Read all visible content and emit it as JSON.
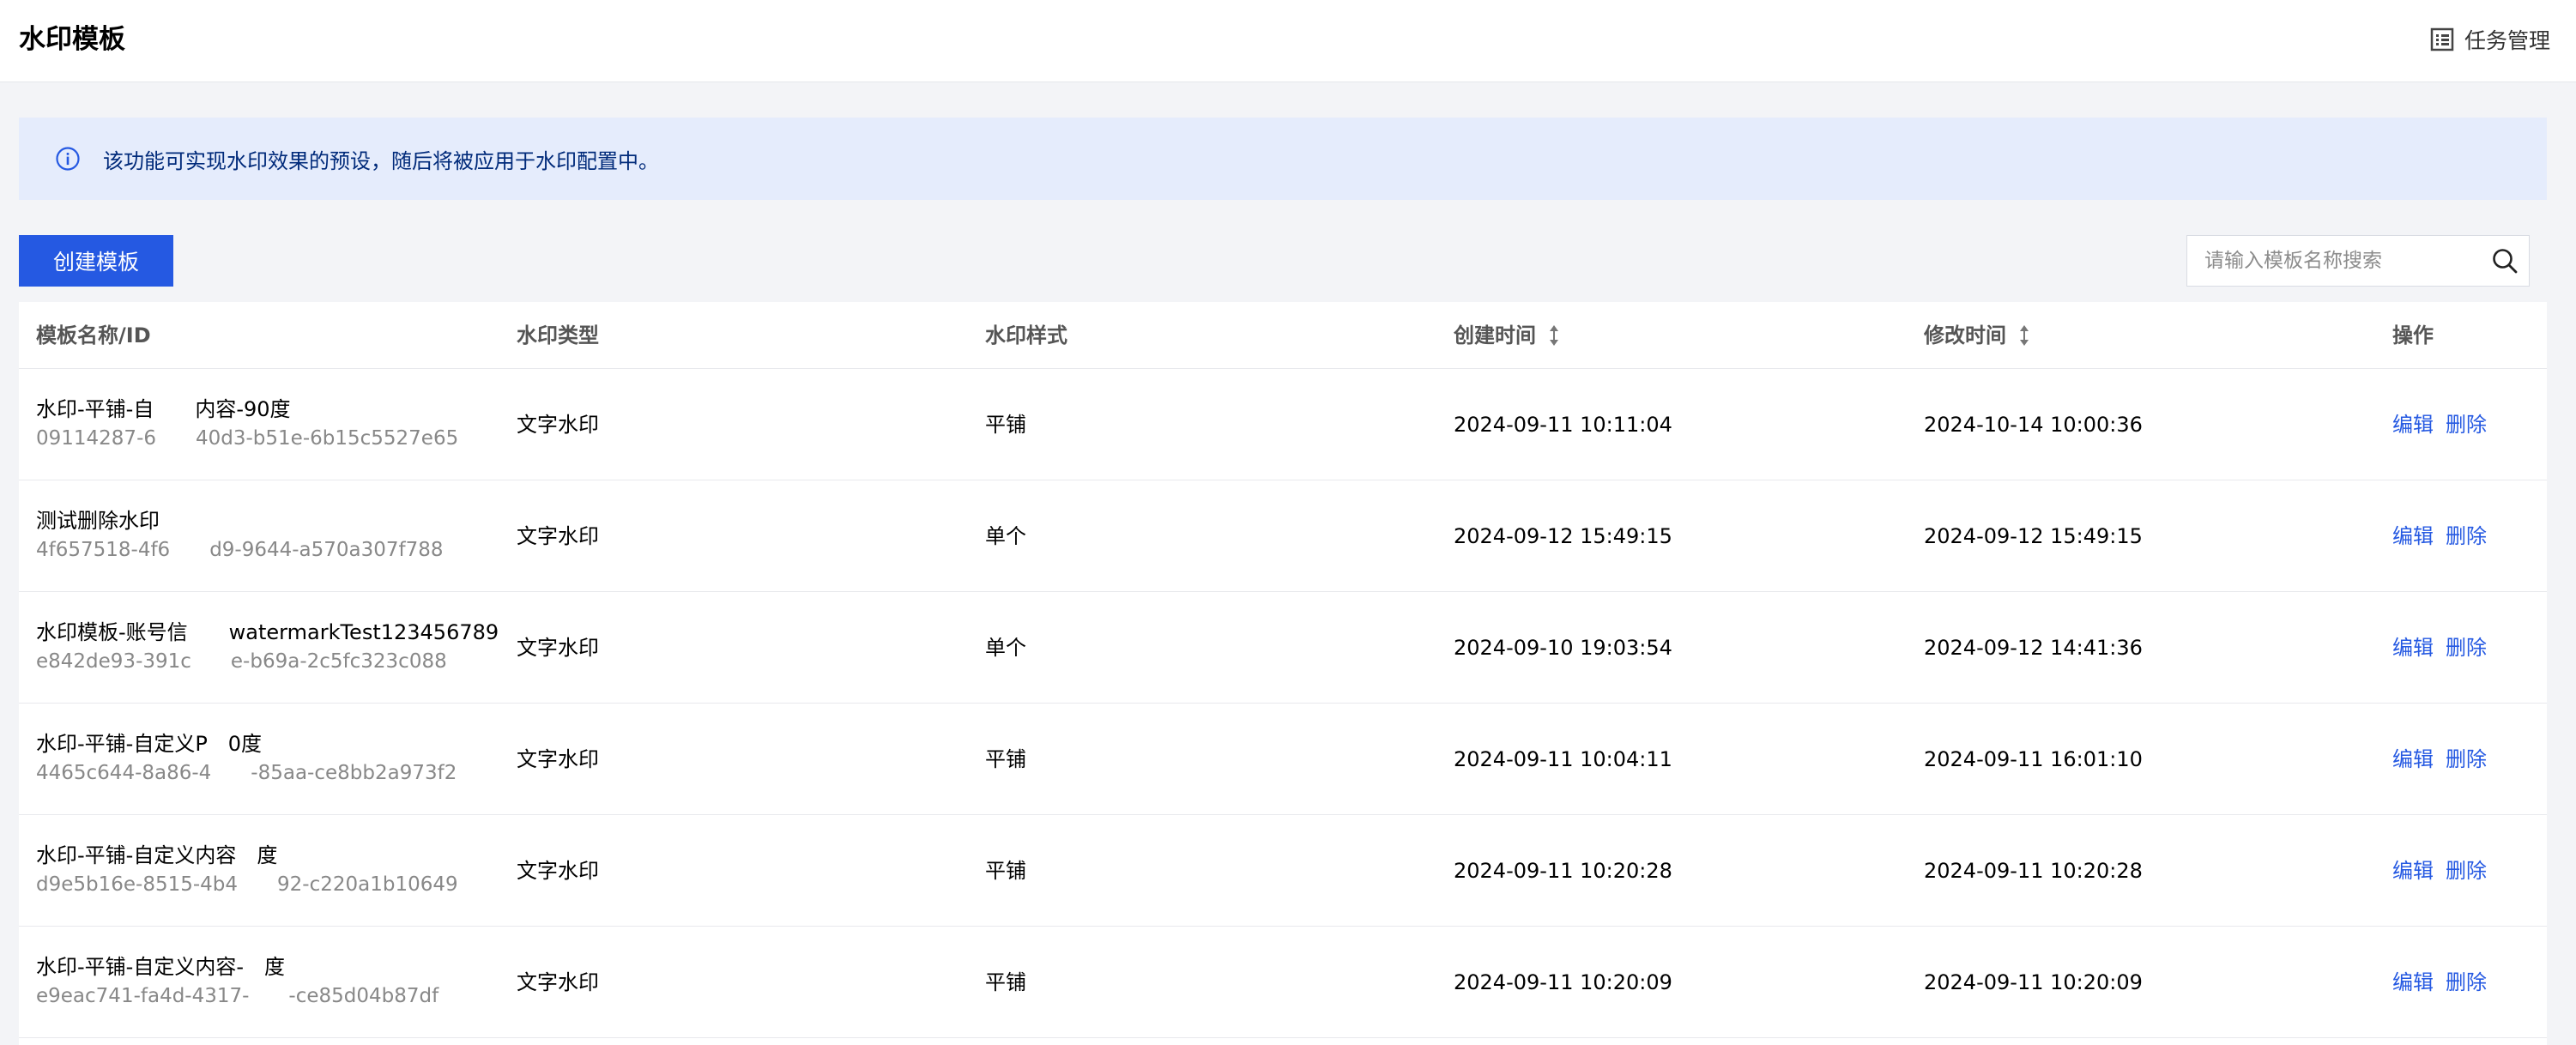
{
  "header": {
    "title": "水印模板",
    "task_management_label": "任务管理"
  },
  "banner": {
    "text": "该功能可实现水印效果的预设，随后将被应用于水印配置中。"
  },
  "toolbar": {
    "create_label": "创建模板",
    "search_placeholder": "请输入模板名称搜索"
  },
  "table": {
    "columns": {
      "name_id": "模板名称/ID",
      "type": "水印类型",
      "style": "水印样式",
      "created": "创建时间",
      "modified": "修改时间",
      "actions": "操作"
    },
    "edit_label": "编辑",
    "delete_label": "删除",
    "rows": [
      {
        "name": "水印-平铺-自　　内容-90度",
        "id": "09114287-6　　40d3-b51e-6b15c5527e65",
        "type": "文字水印",
        "style": "平铺",
        "created": "2024-09-11 10:11:04",
        "modified": "2024-10-14 10:00:36"
      },
      {
        "name": "测试删除水印",
        "id": "4f657518-4f6　　d9-9644-a570a307f788",
        "type": "文字水印",
        "style": "单个",
        "created": "2024-09-12 15:49:15",
        "modified": "2024-09-12 15:49:15"
      },
      {
        "name": "水印模板-账号信　　watermarkTest123456789",
        "id": "e842de93-391c　　e-b69a-2c5fc323c088",
        "type": "文字水印",
        "style": "单个",
        "created": "2024-09-10 19:03:54",
        "modified": "2024-09-12 14:41:36"
      },
      {
        "name": "水印-平铺-自定义P　0度",
        "id": "4465c644-8a86-4　　-85aa-ce8bb2a973f2",
        "type": "文字水印",
        "style": "平铺",
        "created": "2024-09-11 10:04:11",
        "modified": "2024-09-11 16:01:10"
      },
      {
        "name": "水印-平铺-自定义内容　度",
        "id": "d9e5b16e-8515-4b4　　92-c220a1b10649",
        "type": "文字水印",
        "style": "平铺",
        "created": "2024-09-11 10:20:28",
        "modified": "2024-09-11 10:20:28"
      },
      {
        "name": "水印-平铺-自定义内容-　度",
        "id": "e9eac741-fa4d-4317-　　-ce85d04b87df",
        "type": "文字水印",
        "style": "平铺",
        "created": "2024-09-11 10:20:09",
        "modified": "2024-09-11 10:20:09"
      }
    ]
  },
  "colors": {
    "primary": "#2559e2",
    "banner_bg": "#e5ecfc",
    "page_bg": "#f3f4f7"
  }
}
